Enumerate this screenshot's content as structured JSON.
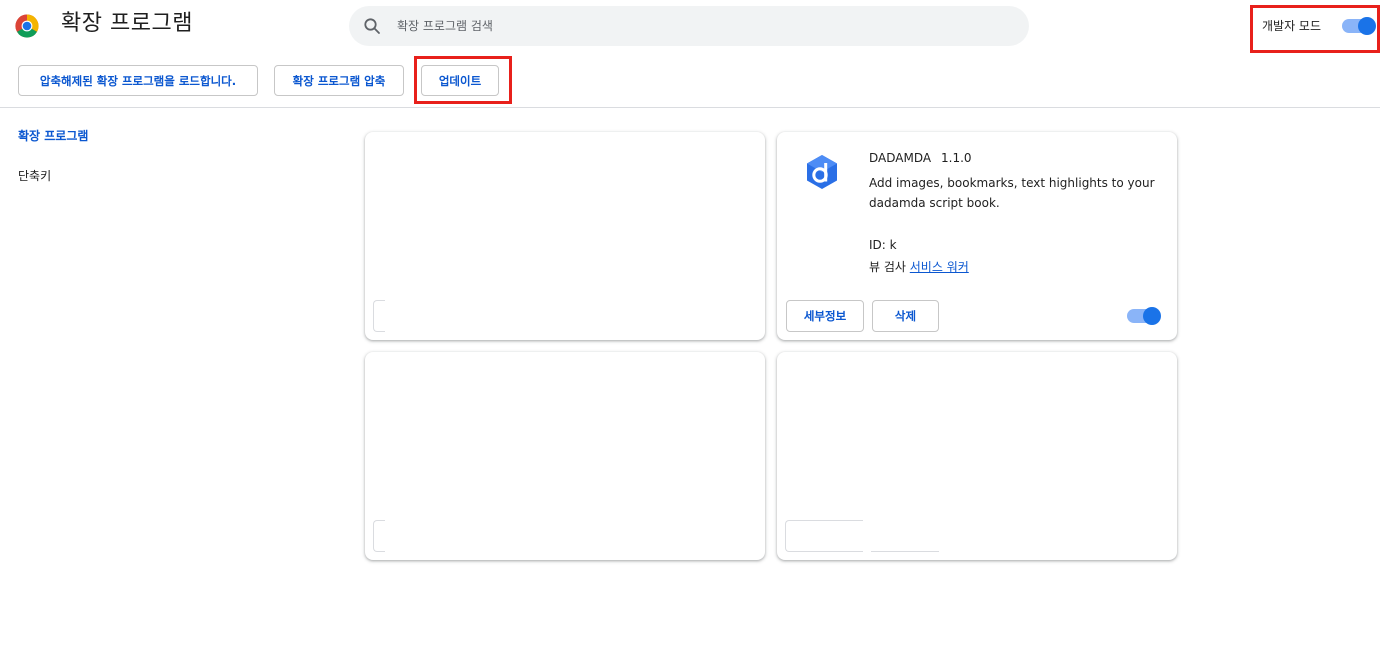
{
  "header": {
    "title": "확장 프로그램",
    "search_placeholder": "확장 프로그램 검색",
    "developer_mode_label": "개발자 모드",
    "developer_mode_on": true
  },
  "toolbar": {
    "load_unpacked_label": "압축해제된 확장 프로그램을 로드합니다.",
    "pack_label": "확장 프로그램 압축",
    "update_label": "업데이트"
  },
  "sidebar": {
    "items": [
      {
        "label": "확장 프로그램",
        "active": true
      },
      {
        "label": "단축키",
        "active": false
      }
    ]
  },
  "extension": {
    "name": "DADAMDA",
    "version": "1.1.0",
    "description": "Add images, bookmarks, text highlights to your dadamda script book.",
    "id_text": "ID: k",
    "inspect_prefix": "뷰 검사",
    "inspect_link": "서비스 워커",
    "details_label": "세부정보",
    "remove_label": "삭제",
    "enabled": true
  },
  "colors": {
    "accent": "#0b57d0",
    "toggle_knob": "#1a73e8",
    "toggle_track": "#8ab4f8",
    "highlight_box": "#e8201b"
  }
}
